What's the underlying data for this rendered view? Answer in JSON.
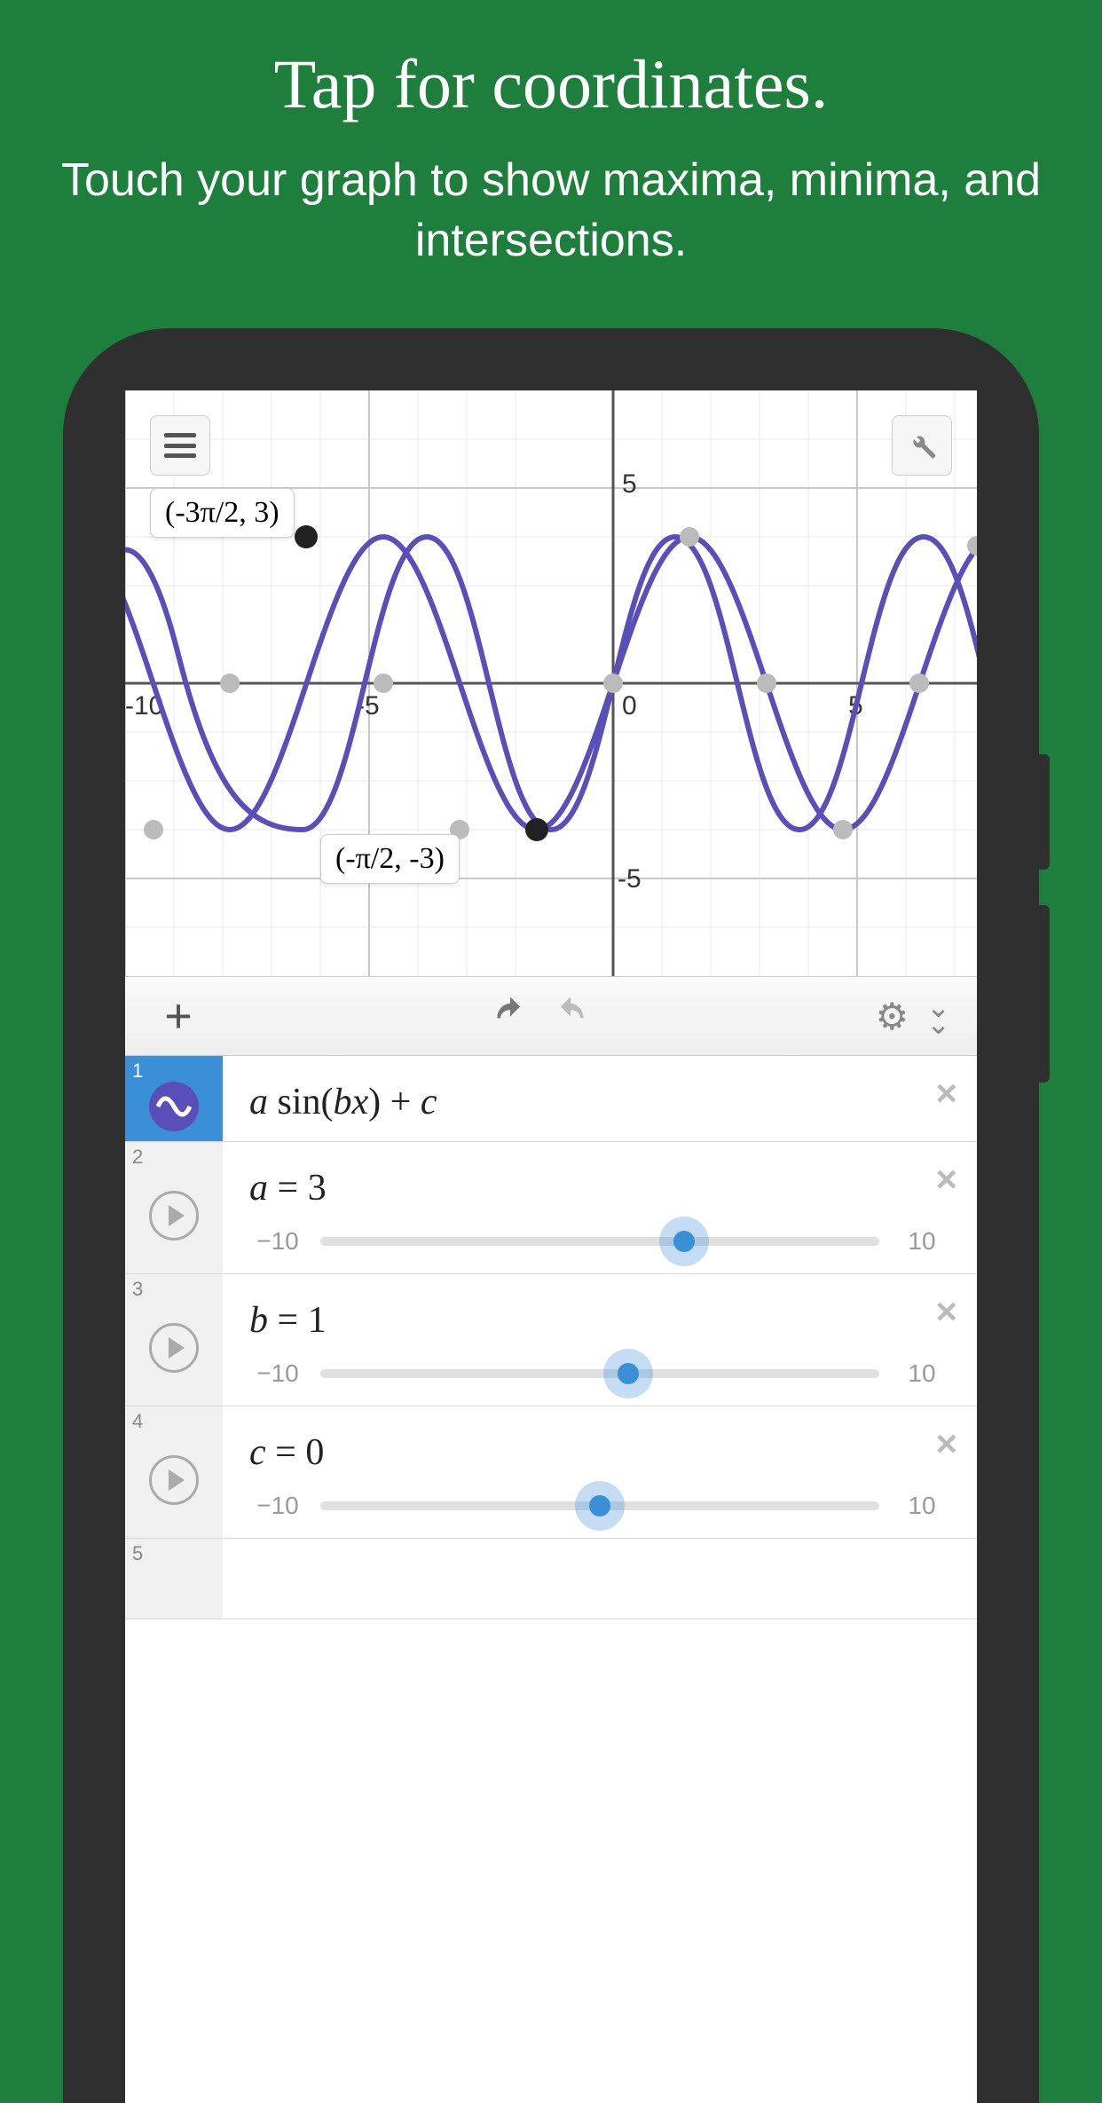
{
  "promo": {
    "title": "Tap for coordinates.",
    "subtitle": "Touch your graph to show maxima, minima, and intersections."
  },
  "graph": {
    "x_ticks": [
      "-10",
      "-5",
      "0",
      "5"
    ],
    "y_ticks": [
      "5",
      "-5"
    ],
    "labels": [
      {
        "text": "(-3π/2, 3)",
        "selected": true
      },
      {
        "text": "(-π/2, -3)",
        "selected": true
      }
    ]
  },
  "chart_data": {
    "type": "line",
    "formula": "a·sin(b·x) + c",
    "params": {
      "a": 3,
      "b": 1,
      "c": 0
    },
    "xlim": [
      -11,
      8
    ],
    "ylim": [
      -6,
      6
    ],
    "annotations": [
      {
        "label": "(-3π/2, 3)",
        "x": -4.712,
        "y": 3
      },
      {
        "label": "(-π/2, -3)",
        "x": -1.571,
        "y": -3
      }
    ]
  },
  "toolbar": {
    "plus": "+",
    "undo_icon": "↶",
    "redo_icon": "↷",
    "gear_icon": "⚙",
    "collapse": "»"
  },
  "expressions": [
    {
      "index": "1",
      "type": "function",
      "display": "a sin(bx) + c"
    },
    {
      "index": "2",
      "type": "slider",
      "var": "a",
      "value": "3",
      "min": "−10",
      "max": "10",
      "pos": 0.65
    },
    {
      "index": "3",
      "type": "slider",
      "var": "b",
      "value": "1",
      "min": "−10",
      "max": "10",
      "pos": 0.55
    },
    {
      "index": "4",
      "type": "slider",
      "var": "c",
      "value": "0",
      "min": "−10",
      "max": "10",
      "pos": 0.5
    },
    {
      "index": "5",
      "type": "empty"
    }
  ]
}
